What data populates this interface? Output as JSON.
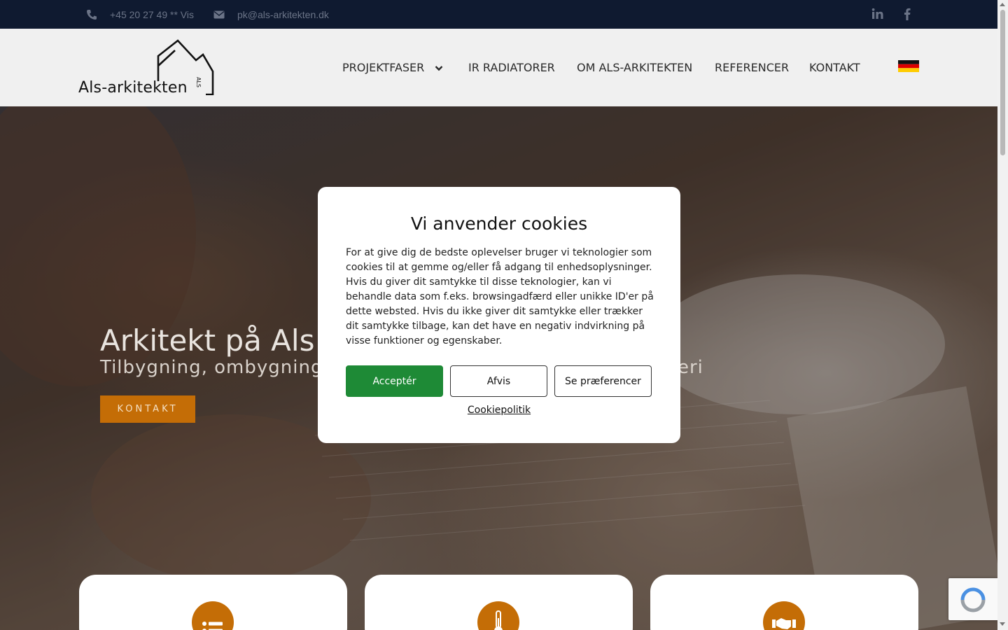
{
  "topbar": {
    "phone": "+45 20 27 49 ** Vis",
    "email": "pk@als-arkitekten.dk",
    "social": [
      "linkedin-icon",
      "facebook-icon"
    ]
  },
  "header": {
    "logo_text": "Als-arkitekten",
    "logo_small": "ALS",
    "nav": [
      "PROJEKTFASER",
      "IR RADIATORER",
      "OM ALS-ARKITEKTEN",
      "REFERENCER",
      "KONTAKT"
    ],
    "language_flag": "german-flag-icon"
  },
  "hero": {
    "title": "Arkitekt på Als r",
    "subtitle": "Tilbygning, ombygning",
    "subtitle_tail": "eri",
    "button": "KONTAKT"
  },
  "cards": [
    {
      "icon": "list-icon"
    },
    {
      "icon": "thermometer-icon"
    },
    {
      "icon": "handshake-icon"
    }
  ],
  "cookie": {
    "title": "Vi anvender cookies",
    "body": "For at give dig de bedste oplevelser bruger vi teknologier som cookies til at gemme og/eller få adgang til enhedsoplysninger. Hvis du giver dit samtykke til disse teknologier, kan vi behandle data som f.eks. browsingadfærd eller unikke ID'er på dette websted. Hvis du ikke giver dit samtykke eller trækker dit samtykke tilbage, kan det have en negativ indvirkning på visse funktioner og egenskaber.",
    "accept": "Acceptér",
    "deny": "Afvis",
    "preferences": "Se præferencer",
    "policy": "Cookiepolitik"
  },
  "colors": {
    "topbar": "#0f1a30",
    "accent": "#c46d06",
    "accept_button": "#1e8a36"
  }
}
